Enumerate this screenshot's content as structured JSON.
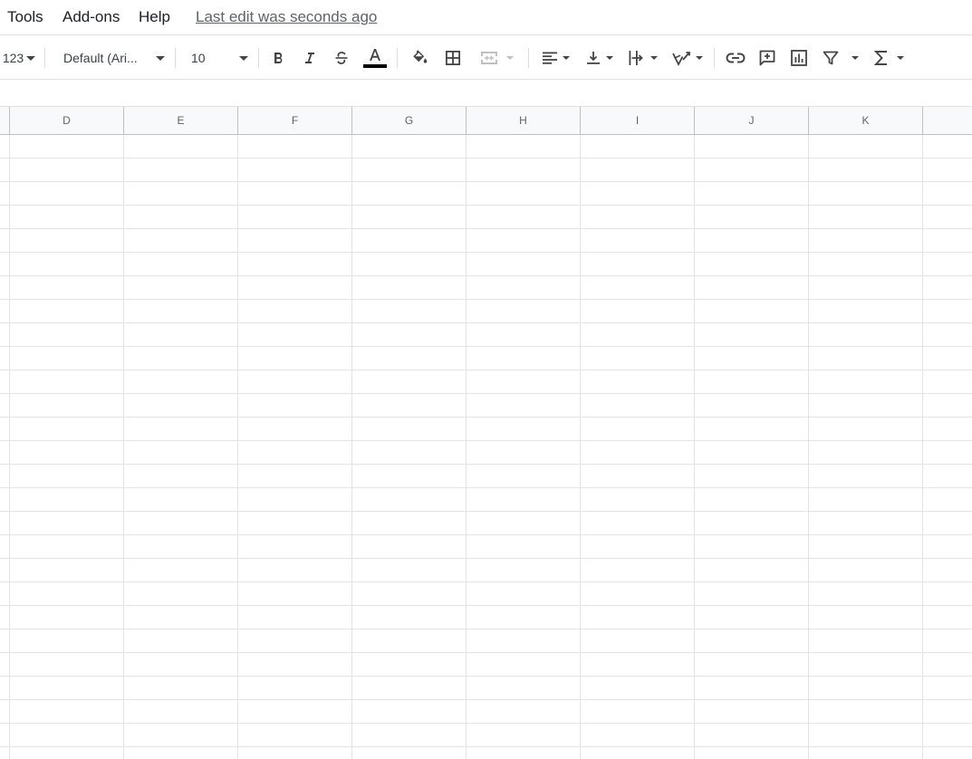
{
  "menubar": {
    "items": [
      "Tools",
      "Add-ons",
      "Help"
    ],
    "last_edit": "Last edit was seconds ago"
  },
  "toolbar": {
    "number_format_label": "123",
    "font_family_value": "Default (Ari...",
    "font_size_value": "10",
    "buttons": [
      "bold-icon",
      "italic-icon",
      "strikethrough-icon",
      "text-color-icon",
      "fill-color-icon",
      "borders-icon",
      "merge-cells-icon",
      "horizontal-align-icon",
      "vertical-align-icon",
      "text-wrapping-icon",
      "text-rotation-icon",
      "link-icon",
      "comment-icon",
      "chart-icon",
      "filter-icon",
      "functions-icon"
    ],
    "text_color": "#000000"
  },
  "columns": [
    "D",
    "E",
    "F",
    "G",
    "H",
    "I",
    "J",
    "K"
  ]
}
